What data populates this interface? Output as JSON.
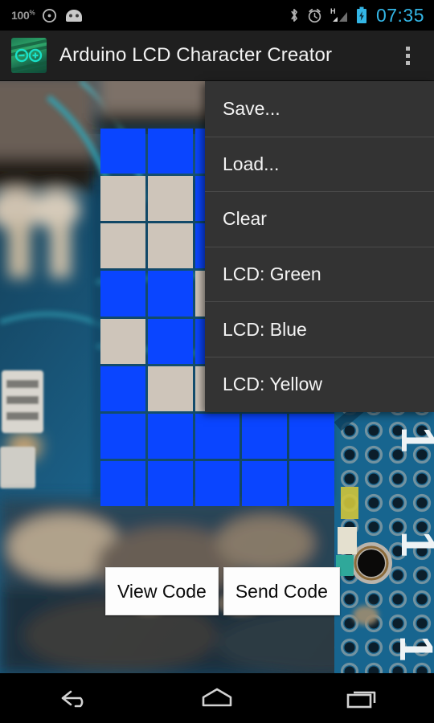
{
  "status_bar": {
    "battery_percent": "100",
    "battery_percent_symbol": "%",
    "clock": "07:35",
    "clock_color": "#33b5e5",
    "left_icons": [
      "battery-percent-text",
      "brightness-auto-icon",
      "android-head-icon"
    ],
    "right_icons": [
      "bluetooth-icon",
      "alarm-clock-icon",
      "hspa-signal-icon",
      "battery-charging-icon"
    ],
    "signal_network_label": "H"
  },
  "action_bar": {
    "app_title": "Arduino LCD Character Creator",
    "logo_name": "arduino-logo",
    "overflow_name": "overflow-menu-button",
    "background_color": "#1f1f1f"
  },
  "overflow_menu": {
    "visible": true,
    "background_color": "#333333",
    "items": [
      {
        "label": "Save...",
        "name": "menu-item-save"
      },
      {
        "label": "Load...",
        "name": "menu-item-load"
      },
      {
        "label": "Clear",
        "name": "menu-item-clear"
      },
      {
        "label": "LCD: Green",
        "name": "menu-item-lcd-green"
      },
      {
        "label": "LCD: Blue",
        "name": "menu-item-lcd-blue"
      },
      {
        "label": "LCD: Yellow",
        "name": "menu-item-lcd-yellow"
      }
    ]
  },
  "lcd_grid": {
    "columns": 5,
    "rows": 8,
    "on_color": "#0a45ff",
    "off_color": "#cec5ba",
    "cells": [
      [
        1,
        1,
        1,
        1,
        1
      ],
      [
        0,
        0,
        1,
        1,
        1
      ],
      [
        0,
        0,
        1,
        1,
        1
      ],
      [
        1,
        1,
        0,
        1,
        1
      ],
      [
        0,
        1,
        1,
        1,
        1
      ],
      [
        1,
        0,
        0,
        1,
        1
      ],
      [
        1,
        1,
        1,
        1,
        1
      ],
      [
        1,
        1,
        1,
        1,
        1
      ]
    ]
  },
  "buttons": {
    "view_code": "View Code",
    "send_code": "Send Code"
  },
  "nav_bar": {
    "back_label": "back-icon",
    "home_label": "home-icon",
    "recents_label": "recents-icon"
  },
  "background": {
    "description": "blurred-circuit-board-photo",
    "base_color": "#12212e",
    "pcb_color": "#1b5f85",
    "silkscreen_color": "#e8eef0"
  }
}
